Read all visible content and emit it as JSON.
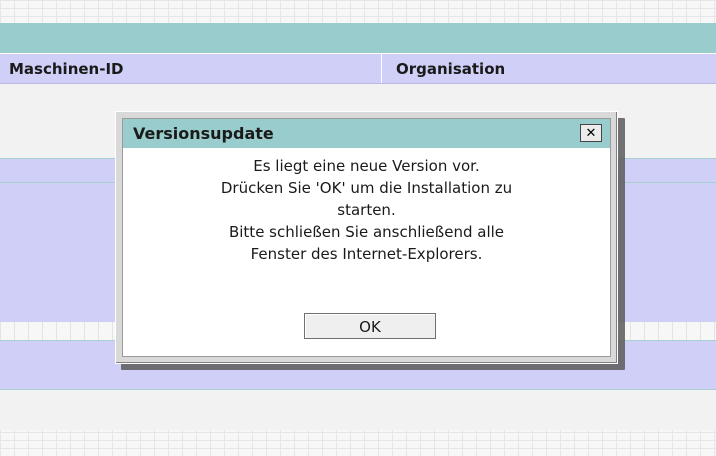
{
  "table": {
    "columns": [
      "Maschinen-ID",
      "Organisation"
    ]
  },
  "dialog": {
    "title": "Versionsupdate",
    "close_glyph": "✕",
    "close_icon": "close-icon",
    "message_lines": [
      "Es liegt eine neue Version vor.",
      "Drücken Sie 'OK' um die Installation zu",
      "starten.",
      "Bitte schließen Sie anschließend alle",
      "Fenster des Internet-Explorers."
    ],
    "ok_label": "OK"
  },
  "colors": {
    "teal_header": "#99cccc",
    "lavender_row": "#cfcff7",
    "dialog_background": "#ffffff"
  }
}
